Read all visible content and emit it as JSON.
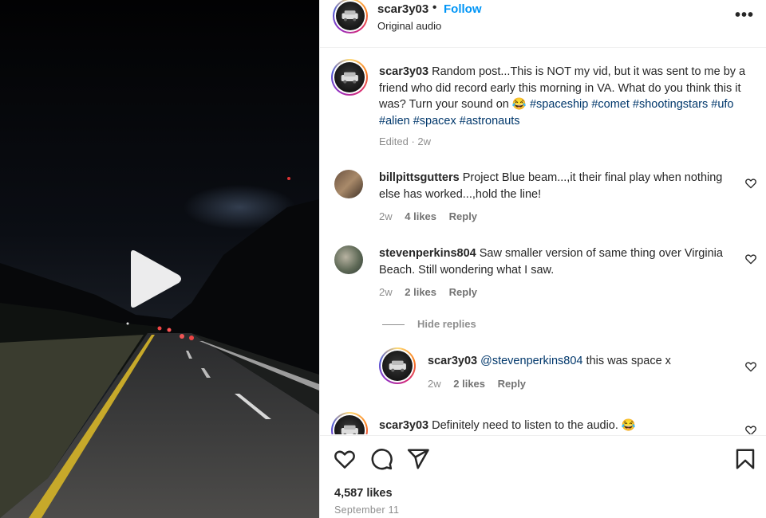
{
  "post": {
    "author": "scar3y03",
    "separator": "•",
    "follow_label": "Follow",
    "audio_label": "Original audio",
    "more_label": "•••"
  },
  "caption": {
    "user": "scar3y03",
    "text": "Random post...This is NOT my vid, but it was sent to me by a friend who did record early this morning in VA. What do you think this it was? Turn your sound on 😂",
    "hashtags": [
      "#spaceship",
      "#comet",
      "#shootingstars",
      "#ufo",
      "#alien",
      "#spacex",
      "#astronauts"
    ],
    "meta": "Edited · 2w"
  },
  "comments": [
    {
      "user": "billpittsgutters",
      "text": "Project Blue beam...,it their final play when nothing else has worked...,hold the line!",
      "age": "2w",
      "likes": "4 likes",
      "reply_label": "Reply"
    },
    {
      "user": "stevenperkins804",
      "text": "Saw smaller version of same thing over Virginia Beach. Still wondering what I saw.",
      "age": "2w",
      "likes": "2 likes",
      "reply_label": "Reply"
    }
  ],
  "hide_replies_label": "Hide replies",
  "reply": {
    "user": "scar3y03",
    "mention": "@stevenperkins804",
    "text": "this was space x",
    "age": "2w",
    "likes": "2 likes",
    "reply_label": "Reply"
  },
  "last_comment": {
    "user": "scar3y03",
    "text": "Definitely need to listen to the audio. 😂"
  },
  "footer": {
    "likes": "4,587 likes",
    "date": "September 11"
  },
  "icons": {
    "like": "heart-icon",
    "comment": "comment-icon",
    "share": "share-icon",
    "save": "bookmark-icon",
    "play": "play-icon",
    "more": "more-icon"
  },
  "colors": {
    "link": "#0095f6",
    "hashtag": "#00376b",
    "secondary": "#8e8e8e"
  }
}
